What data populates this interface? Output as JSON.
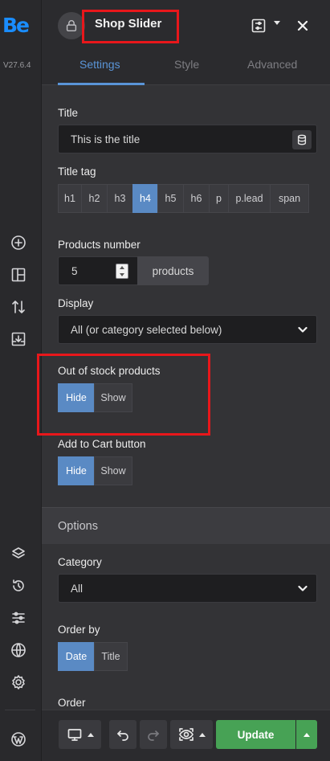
{
  "app": {
    "logo": "Be",
    "version": "V27.6.4"
  },
  "rail": {
    "icons": [
      "add-icon",
      "layout-icon",
      "sort-icon",
      "import-icon",
      "layers-icon",
      "history-icon",
      "sliders-icon",
      "globe-icon",
      "settings-icon",
      "wordpress-icon"
    ]
  },
  "header": {
    "title": "Shop Slider",
    "icons": [
      "lock-icon",
      "presets-icon",
      "chevron-down-icon",
      "close-icon"
    ]
  },
  "tabs": [
    {
      "label": "Settings",
      "active": true
    },
    {
      "label": "Style",
      "active": false
    },
    {
      "label": "Advanced",
      "active": false
    }
  ],
  "form": {
    "title": {
      "label": "Title",
      "value": "This is the title"
    },
    "title_tag": {
      "label": "Title tag",
      "options": [
        "h1",
        "h2",
        "h3",
        "h4",
        "h5",
        "h6",
        "p",
        "p.lead",
        "span"
      ],
      "selected": "h4"
    },
    "products_number": {
      "label": "Products number",
      "value": "5",
      "unit": "products"
    },
    "display": {
      "label": "Display",
      "value": "All (or category selected below)"
    },
    "out_of_stock": {
      "label": "Out of stock products",
      "options": [
        "Hide",
        "Show"
      ],
      "selected": "Hide"
    },
    "add_to_cart": {
      "label": "Add to Cart button",
      "options": [
        "Hide",
        "Show"
      ],
      "selected": "Hide"
    }
  },
  "options_section": {
    "title": "Options",
    "category": {
      "label": "Category",
      "value": "All"
    },
    "order_by": {
      "label": "Order by",
      "options": [
        "Date",
        "Title"
      ],
      "selected": "Date"
    },
    "order": {
      "label": "Order"
    }
  },
  "footer": {
    "update_label": "Update",
    "icons": [
      "desktop-icon",
      "undo-icon",
      "redo-icon",
      "preview-icon"
    ]
  },
  "colors": {
    "accent": "#5a8ac4",
    "brand": "#1a8dff",
    "update": "#47a255",
    "highlight": "#e8171b"
  }
}
